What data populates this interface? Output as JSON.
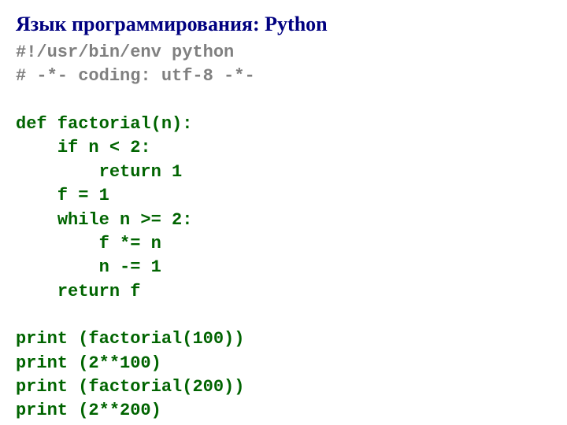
{
  "title": "Язык программирования: Python",
  "code": {
    "l1": "#!/usr/bin/env python",
    "l2": "# -*- coding: utf-8 -*-",
    "l3": "",
    "l4_kw": "def",
    "l4_rest": " factorial(n):",
    "l5_pre": "    ",
    "l5_kw": "if",
    "l5_rest": " n < 2:",
    "l6_pre": "        ",
    "l6_kw": "return",
    "l6_rest": " 1",
    "l7": "    f = 1",
    "l8_pre": "    ",
    "l8_kw": "while",
    "l8_rest": " n >= 2:",
    "l9": "        f *= n",
    "l10": "        n -= 1",
    "l11_pre": "    ",
    "l11_kw": "return",
    "l11_rest": " f",
    "l12": "",
    "l13_kw": "print",
    "l13_rest": " (factorial(100))",
    "l14_kw": "print",
    "l14_rest": " (2**100)",
    "l15_kw": "print",
    "l15_rest": " (factorial(200))",
    "l16_kw": "print",
    "l16_rest": " (2**200)"
  }
}
